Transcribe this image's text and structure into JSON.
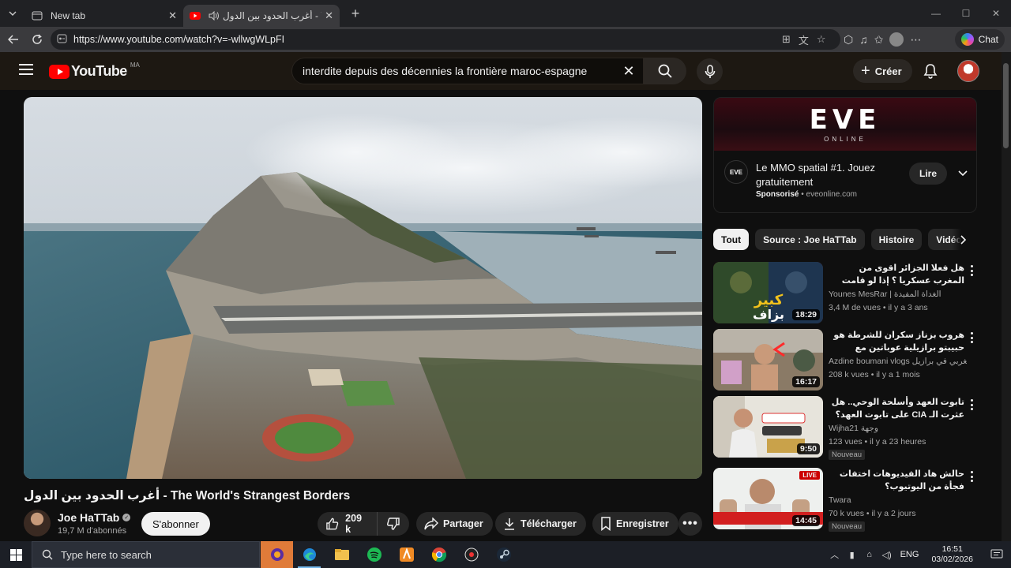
{
  "browser": {
    "tabs": [
      {
        "title": "New tab",
        "active": false
      },
      {
        "title": "أغرب الحدود بين الدول - YouTube",
        "active": true
      }
    ],
    "url": "https://www.youtube.com/watch?v=-wllwgWLpFI",
    "chat_label": "Chat"
  },
  "youtube": {
    "logo_text": "YouTube",
    "country_code": "MA",
    "search_query": "interdite depuis des décennies la frontière maroc-espagne",
    "create_label": "Créer"
  },
  "video": {
    "title": "أغرب الحدود بين الدول - The World's Strangest Borders",
    "channel_name": "Joe HaTTab",
    "subscribers": "19,7 M d'abonnés",
    "subscribe_label": "S'abonner",
    "likes": "209 k",
    "share_label": "Partager",
    "download_label": "Télécharger",
    "save_label": "Enregistrer"
  },
  "ad": {
    "banner_logo": "EVE",
    "banner_sub": "ONLINE",
    "icon_text": "EVE",
    "title": "Le MMO spatial #1. Jouez gratuitement",
    "sponsored": "Sponsorisé",
    "domain": "eveonline.com",
    "button_label": "Lire"
  },
  "chips": [
    "Tout",
    "Source : Joe HaTTab",
    "Histoire",
    "Vidéos"
  ],
  "recommendations": [
    {
      "title": "هل فعلا الجزائر اقوى من المغرب عسكريا ؟ إذا لو قامت الحرب بين المغرب و الجزائر؟",
      "channel": "Younes MesRar | الغداة المفيدة",
      "meta": "3,4 M de vues • il y a 3 ans",
      "duration": "18:29",
      "new": false,
      "live": false
    },
    {
      "title": "هروب بزناز سكران للشرطة هو حبيبتو برازيلية عوباتين مع مغربي BRMA 😱 ...",
      "channel": "Azdine boumani vlogs مغربي في برازيل",
      "meta": "208 k vues • il y a 1 mois",
      "duration": "16:17",
      "new": false,
      "live": false
    },
    {
      "title": "تابوت العهد وأسلحة الوحي.. هل عثرت الـ CIA على تابوت العهد؟ وثائق سرّية تقلب ...",
      "channel": "Wijha21 وجهة",
      "meta": "123 vues • il y a 23 heures",
      "duration": "9:50",
      "new": true,
      "live": false
    },
    {
      "title": "حالش هاد الفيديوهات اختفات فجأة من اليوتيوب؟",
      "channel": "Twara",
      "meta": "70 k vues • il y a 2 jours",
      "duration": "14:45",
      "new": true,
      "live": true
    }
  ],
  "new_badge": "Nouveau",
  "live_badge": "LIVE",
  "taskbar": {
    "search_placeholder": "Type here to search",
    "language": "ENG",
    "time": "16:51",
    "date": "03/02/2026"
  }
}
